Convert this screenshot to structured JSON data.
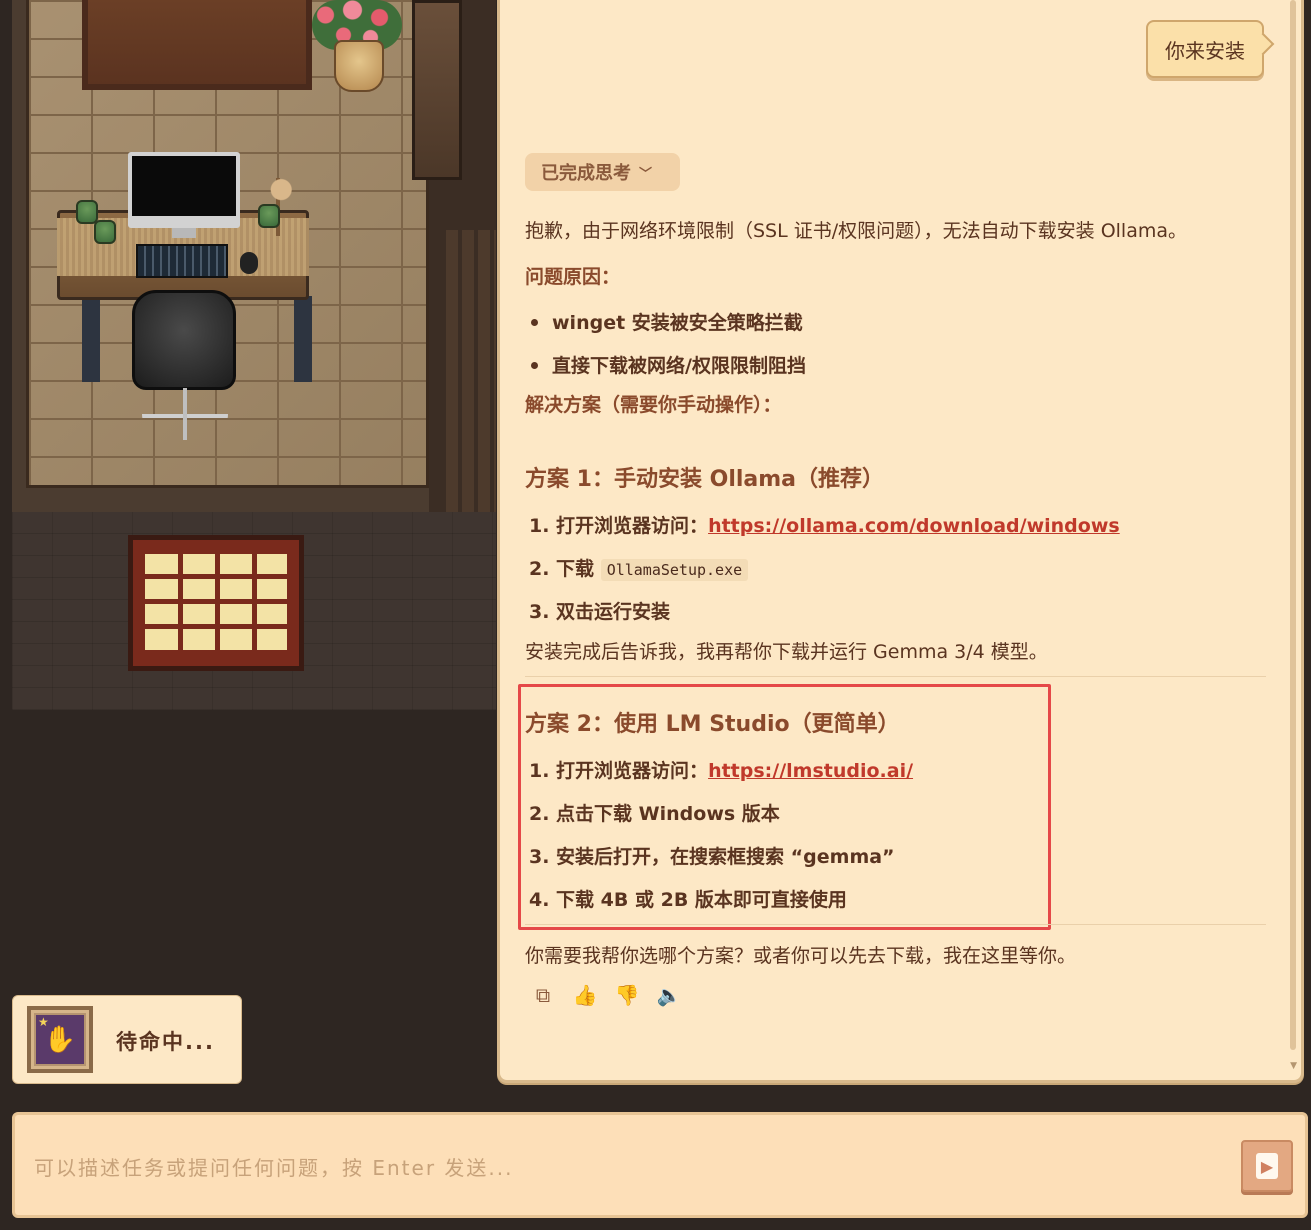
{
  "chat": {
    "user_message": "你来安装",
    "thinking_label": "已完成思考",
    "intro": "抱歉，由于网络环境限制（SSL 证书/权限问题），无法自动下载安装 Ollama。",
    "problem_title": "问题原因：",
    "problems": [
      "winget 安装被安全策略拦截",
      "直接下载被网络/权限限制阻挡"
    ],
    "solution_title": "解决方案（需要你手动操作）：",
    "plan1": {
      "title": "方案 1：手动安装 Ollama（推荐）",
      "step1_prefix": "1. 打开浏览器访问：",
      "step1_link": "https://ollama.com/download/windows",
      "step2_prefix": "2. 下载",
      "step2_code": "OllamaSetup.exe",
      "step3": "3. 双击运行安装",
      "note": "安装完成后告诉我，我再帮你下载并运行 Gemma 3/4 模型。"
    },
    "plan2": {
      "title": "方案 2：使用 LM Studio（更简单）",
      "step1_prefix": "1. 打开浏览器访问：",
      "step1_link": "https://lmstudio.ai/",
      "step2": "2. 点击下载 Windows 版本",
      "step3": "3. 安装后打开，在搜索框搜索 “gemma”",
      "step4": "4. 下载 4B 或 2B 版本即可直接使用"
    },
    "closing": "你需要我帮你选哪个方案？或者你可以先去下载，我在这里等你。"
  },
  "actions": [
    {
      "name": "copy-icon",
      "glyph": "⧉"
    },
    {
      "name": "thumbs-up-icon",
      "glyph": "👍"
    },
    {
      "name": "thumbs-down-icon",
      "glyph": "👎"
    },
    {
      "name": "speaker-icon",
      "glyph": "🔈"
    }
  ],
  "status": {
    "label": "待命中..."
  },
  "input": {
    "placeholder": "可以描述任务或提问任何问题，按 Enter 发送..."
  },
  "colors": {
    "panel_bg": "#fde8c6",
    "link": "#c0392b",
    "highlight_border": "#e54848",
    "page_bg": "#2e2622"
  }
}
